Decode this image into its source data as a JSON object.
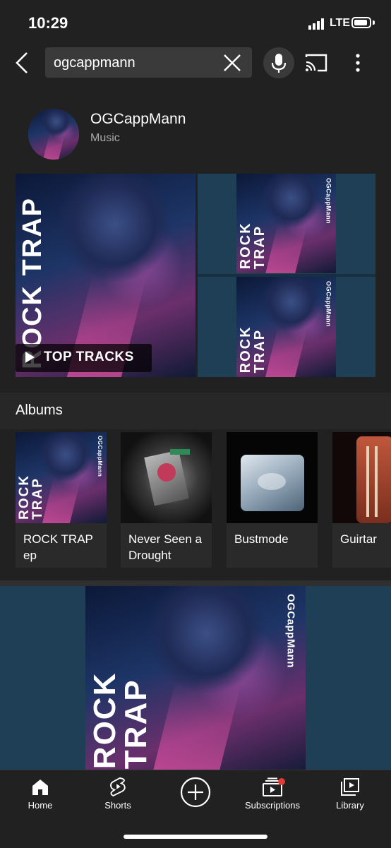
{
  "status_bar": {
    "time": "10:29",
    "network": "LTE"
  },
  "search": {
    "query": "ogcappmann"
  },
  "channel": {
    "name": "OGCappMann",
    "subtitle": "Music"
  },
  "featured": {
    "cta": "TOP TRACKS",
    "art_title": "ROCK TRAP",
    "art_credit": "OGCappMann"
  },
  "albums": {
    "title": "Albums",
    "items": [
      {
        "label": "ROCK TRAP ep"
      },
      {
        "label": "Never Seen a Drought"
      },
      {
        "label": "Bustmode"
      },
      {
        "label": "Guirtar"
      }
    ]
  },
  "nav": {
    "items": [
      {
        "label": "Home"
      },
      {
        "label": "Shorts"
      },
      {
        "label": "Subscriptions"
      },
      {
        "label": "Library"
      }
    ]
  },
  "colors": {
    "background": "#212121",
    "art_backdrop": "#1f3f56",
    "notification_dot": "#e53935"
  }
}
